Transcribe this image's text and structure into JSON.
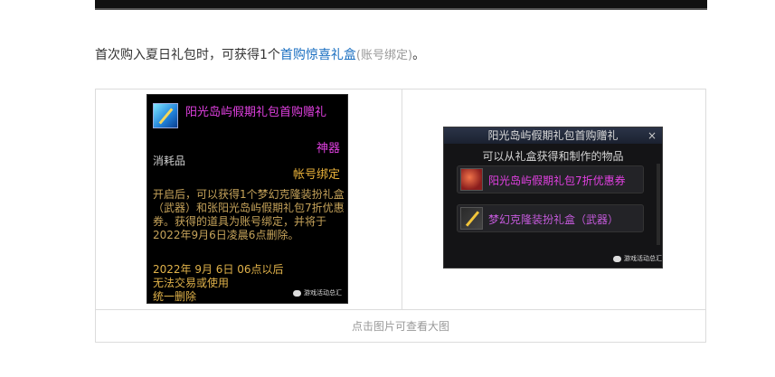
{
  "intro": {
    "prefix": "首次购入夏日礼包时，可获得1个",
    "link": "首购惊喜礼盒",
    "note": "(账号绑定)",
    "suffix": "。"
  },
  "tooltip_left": {
    "title": "阳光岛屿假期礼包首购赠礼",
    "rarity": "神器",
    "kind": "消耗品",
    "bind": "帐号绑定",
    "desc": "开启后，可以获得1个梦幻克隆装扮礼盒（武器）和张阳光岛屿假期礼包7折优惠券。获得的道具为账号绑定，并将于2022年9月6日凌晨6点删除。",
    "expire_line1": "2022年 9月 6日 06点以后",
    "expire_line2": "无法交易或使用",
    "expire_line3": "统一删除",
    "watermark": "游戏活动总汇"
  },
  "window_right": {
    "title": "阳光岛屿假期礼包首购赠礼",
    "close": "×",
    "subtitle": "可以从礼盒获得和制作的物品",
    "items": [
      {
        "label": "阳光岛屿假期礼包7折优惠券"
      },
      {
        "label": "梦幻克隆装扮礼盒（武器）"
      }
    ],
    "watermark": "游戏活动总汇"
  },
  "caption": "点击图片可查看大图"
}
